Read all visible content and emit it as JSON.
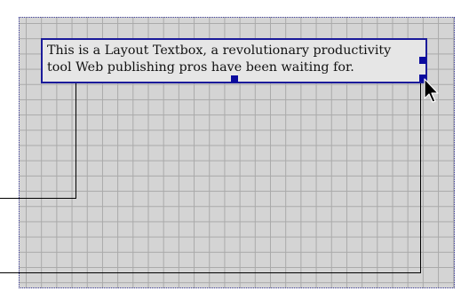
{
  "textbox": {
    "line1": "This is a Layout Textbox, a revolutionary productivity",
    "line2": "tool Web publishing pros have been waiting for."
  },
  "icons": {
    "cursor": "arrow-pointer-icon"
  },
  "colors": {
    "canvas_background": "#d4d4d4",
    "grid_line": "#a9a9a9",
    "selection_border": "#1a1a9a",
    "handle": "#0b0b9e"
  }
}
